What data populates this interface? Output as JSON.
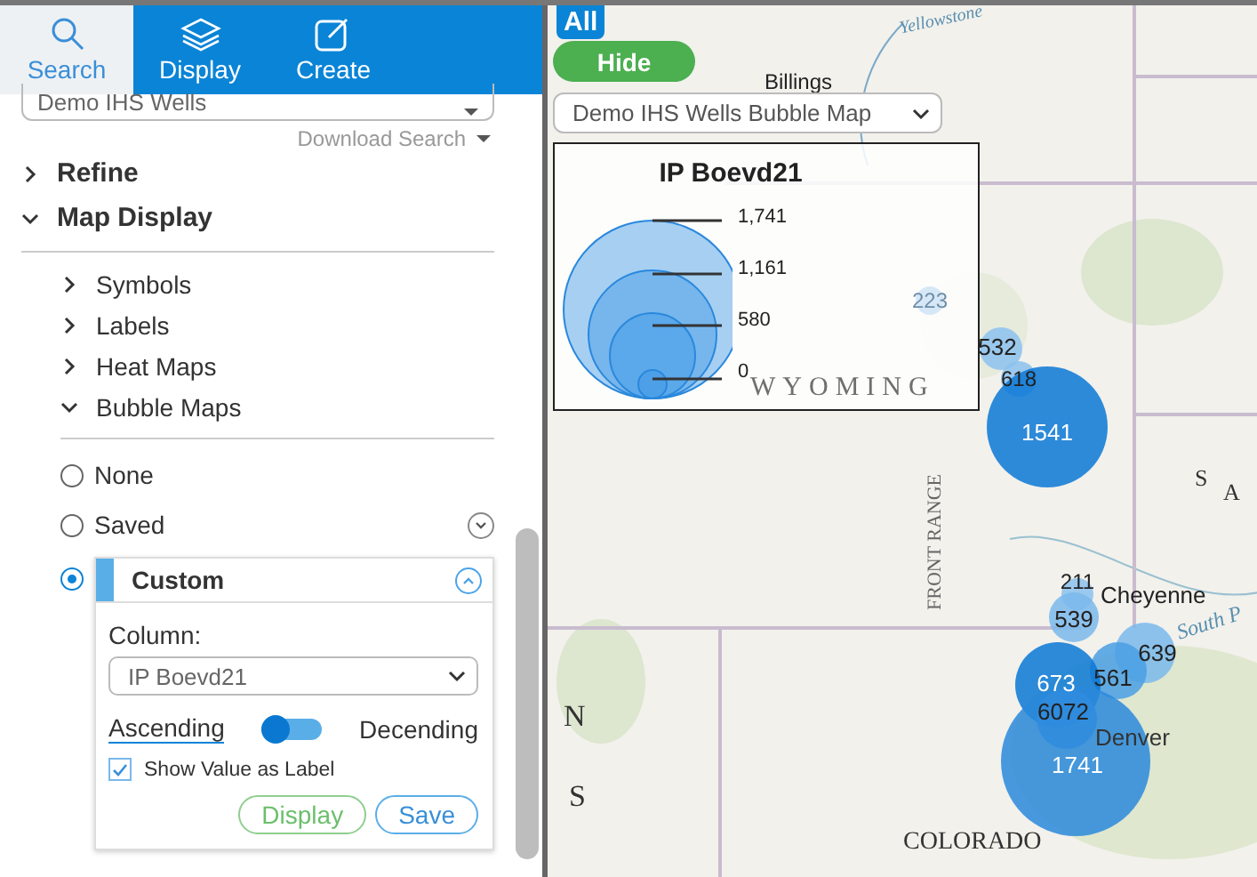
{
  "tabs": [
    {
      "label": "Search",
      "selected": true
    },
    {
      "label": "Display",
      "selected": false
    },
    {
      "label": "Create",
      "selected": false
    }
  ],
  "search_select": {
    "value": "Demo IHS Wells"
  },
  "download_link": "Download Search",
  "sections": [
    {
      "label": "Refine",
      "expanded": false
    },
    {
      "label": "Map Display",
      "expanded": true,
      "children": [
        {
          "label": "Symbols",
          "expanded": false
        },
        {
          "label": "Labels",
          "expanded": false
        },
        {
          "label": "Heat Maps",
          "expanded": false
        },
        {
          "label": "Bubble Maps",
          "expanded": true
        }
      ]
    }
  ],
  "bubble_options": [
    {
      "label": "None",
      "selected": false
    },
    {
      "label": "Saved",
      "selected": false
    },
    {
      "label": "Custom",
      "selected": true
    }
  ],
  "custom": {
    "column_label": "Column:",
    "column_value": "IP Boevd21",
    "ascending_label": "Ascending",
    "descending_label": "Decending",
    "descending": false,
    "show_value_as_label": {
      "label": "Show Value as Label",
      "checked": true
    },
    "buttons": [
      {
        "label": "Display",
        "kind": "secondary"
      },
      {
        "label": "Save",
        "kind": "primary"
      }
    ]
  },
  "map": {
    "all_button": "All",
    "hide_button": "Hide",
    "layer_select": "Demo IHS Wells Bubble Map",
    "legend": {
      "title": "IP Boevd21",
      "ticks": [
        "1,741",
        "1,161",
        "580",
        "0"
      ]
    },
    "place_labels": [
      "Yellowstone",
      "Billings",
      "WYOMING",
      "COLORADO",
      "Cheyenne",
      "Denver",
      "FRONT RANGE",
      "S",
      "A",
      "South P",
      "N",
      "S"
    ],
    "bubbles": [
      {
        "label": "223"
      },
      {
        "label": "532"
      },
      {
        "label": "618"
      },
      {
        "label": "1541"
      },
      {
        "label": "211"
      },
      {
        "label": "539"
      },
      {
        "label": "639"
      },
      {
        "label": "561"
      },
      {
        "label": "673"
      },
      {
        "label": "6072"
      },
      {
        "label": "1741"
      }
    ]
  }
}
